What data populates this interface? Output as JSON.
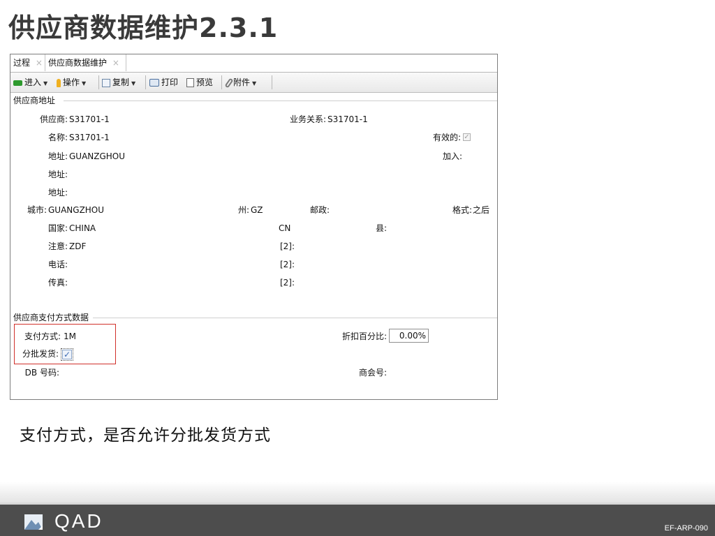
{
  "slide": {
    "title": "供应商数据维护2.3.1",
    "caption": "支付方式，是否允许分批发货方式",
    "footer_code": "EF-ARP-090",
    "logo_text": "QAD"
  },
  "tabs": [
    {
      "label": "过程",
      "close": "×"
    },
    {
      "label": "供应商数据维护",
      "close": "×"
    }
  ],
  "toolbar": {
    "enter": "进入",
    "operate": "操作",
    "copy": "复制",
    "print": "打印",
    "preview": "预览",
    "attach": "附件"
  },
  "address_section": {
    "header": "供应商地址",
    "supplier_label": "供应商:",
    "supplier_value": "S31701-1",
    "relation_label": "业务关系:",
    "relation_value": "S31701-1",
    "name_label": "名称:",
    "name_value": "S31701-1",
    "active_label": "有效的:",
    "active_checked": true,
    "address1_label": "地址:",
    "address1_value": "GUANZGHOU",
    "join_label": "加入:",
    "address2_label": "地址:",
    "address3_label": "地址:",
    "city_label": "城市:",
    "city_value": "GUANGZHOU",
    "state_label": "州:",
    "state_value": "GZ",
    "postal_label": "邮政:",
    "format_label": "格式:",
    "format_value": "之后",
    "country_label": "国家:",
    "country_value": "CHINA",
    "country_code": "CN",
    "county_label": "县:",
    "attention_label": "注意:",
    "attention_value": "ZDF",
    "attention2_label": "[2]:",
    "phone_label": "电话:",
    "phone2_label": "[2]:",
    "fax_label": "传真:",
    "fax2_label": "[2]:"
  },
  "payment_section": {
    "header": "供应商支付方式数据",
    "payment_method_label": "支付方式:",
    "payment_method_value": "1M",
    "discount_label": "折扣百分比:",
    "discount_value": "0.00%",
    "partial_label": "分批发货:",
    "partial_checked": true,
    "db_label": "DB 号码:",
    "chamber_label": "商会号:"
  },
  "colors": {
    "highlight": "#d0302a",
    "footer_bg": "#4d4d4d",
    "title_text": "#3a3a3a"
  }
}
